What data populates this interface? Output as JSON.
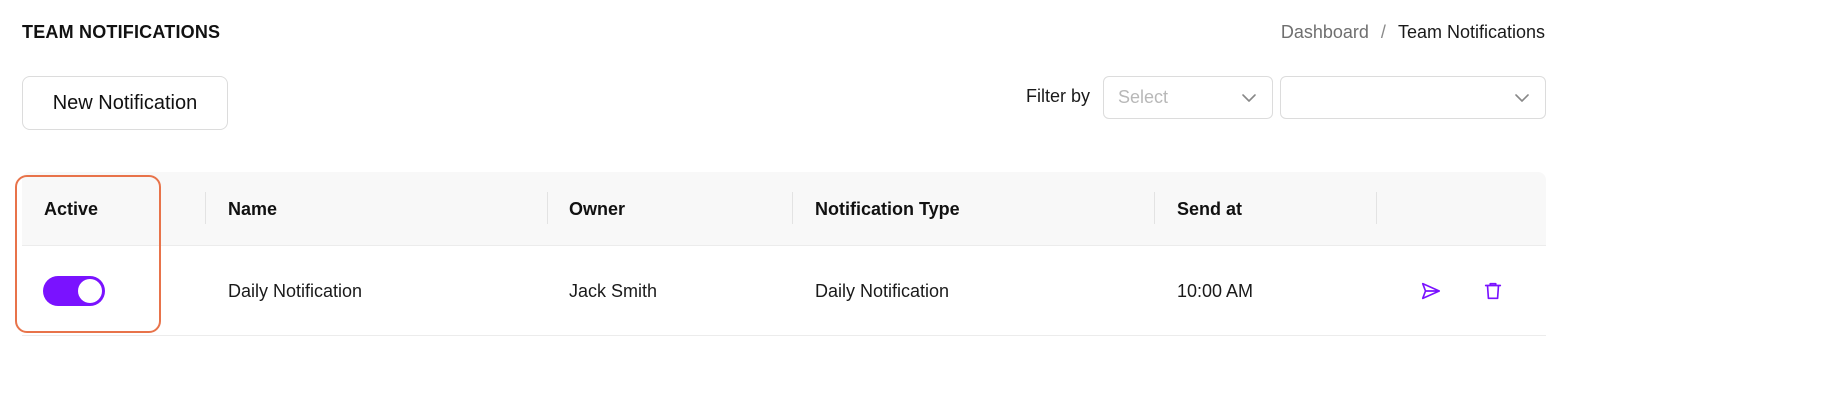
{
  "header": {
    "title": "TEAM NOTIFICATIONS",
    "breadcrumb": {
      "root": "Dashboard",
      "separator": "/",
      "current": "Team Notifications"
    }
  },
  "toolbar": {
    "new_label": "New Notification",
    "filter_label": "Filter by",
    "filter_select_1": {
      "placeholder": "Select"
    },
    "filter_select_2": {
      "placeholder": ""
    }
  },
  "table": {
    "columns": {
      "active": "Active",
      "name": "Name",
      "owner": "Owner",
      "type": "Notification Type",
      "send_at": "Send at"
    },
    "rows": [
      {
        "active": true,
        "name": "Daily Notification",
        "owner": "Jack Smith",
        "type": "Daily Notification",
        "send_at": "10:00 AM"
      }
    ]
  },
  "colors": {
    "accent": "#7a12ff",
    "highlight": "#e8734a"
  },
  "icons": {
    "send": "send-icon",
    "delete": "trash-icon",
    "dropdown": "chevron-down-icon"
  }
}
